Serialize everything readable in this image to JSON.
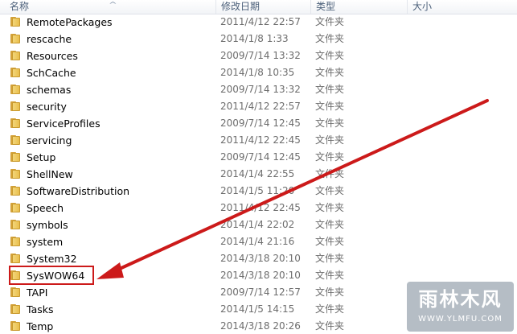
{
  "columns": {
    "name": "名称",
    "date": "修改日期",
    "type": "类型",
    "size": "大小"
  },
  "rows": [
    {
      "name": "RemotePackages",
      "date": "2011/4/12 22:57",
      "type": "文件夹"
    },
    {
      "name": "rescache",
      "date": "2014/1/8 1:33",
      "type": "文件夹"
    },
    {
      "name": "Resources",
      "date": "2009/7/14 13:32",
      "type": "文件夹"
    },
    {
      "name": "SchCache",
      "date": "2014/1/8 10:35",
      "type": "文件夹"
    },
    {
      "name": "schemas",
      "date": "2009/7/14 13:32",
      "type": "文件夹"
    },
    {
      "name": "security",
      "date": "2011/4/12 22:57",
      "type": "文件夹"
    },
    {
      "name": "ServiceProfiles",
      "date": "2009/7/14 12:45",
      "type": "文件夹"
    },
    {
      "name": "servicing",
      "date": "2011/4/12 22:45",
      "type": "文件夹"
    },
    {
      "name": "Setup",
      "date": "2009/7/14 12:45",
      "type": "文件夹"
    },
    {
      "name": "ShellNew",
      "date": "2014/1/4 22:55",
      "type": "文件夹"
    },
    {
      "name": "SoftwareDistribution",
      "date": "2014/1/5 11:20",
      "type": "文件夹"
    },
    {
      "name": "Speech",
      "date": "2011/4/12 22:45",
      "type": "文件夹"
    },
    {
      "name": "symbols",
      "date": "2014/1/4 22:02",
      "type": "文件夹"
    },
    {
      "name": "system",
      "date": "2014/1/4 21:16",
      "type": "文件夹"
    },
    {
      "name": "System32",
      "date": "2014/3/18 20:10",
      "type": "文件夹"
    },
    {
      "name": "SysWOW64",
      "date": "2014/3/18 20:10",
      "type": "文件夹"
    },
    {
      "name": "TAPI",
      "date": "2009/7/14 12:57",
      "type": "文件夹"
    },
    {
      "name": "Tasks",
      "date": "2014/1/5 14:15",
      "type": "文件夹"
    },
    {
      "name": "Temp",
      "date": "2014/3/18 20:26",
      "type": "文件夹"
    }
  ],
  "highlighted_row": "SysWOW64",
  "annotation_color": "#cc1a1a",
  "icons": {
    "row_icon": "folder-icon",
    "sort": "sort-ascending-arrow-icon"
  },
  "watermark": {
    "logo": "雨林木风",
    "url": "WWW.YLMFU.COM"
  }
}
